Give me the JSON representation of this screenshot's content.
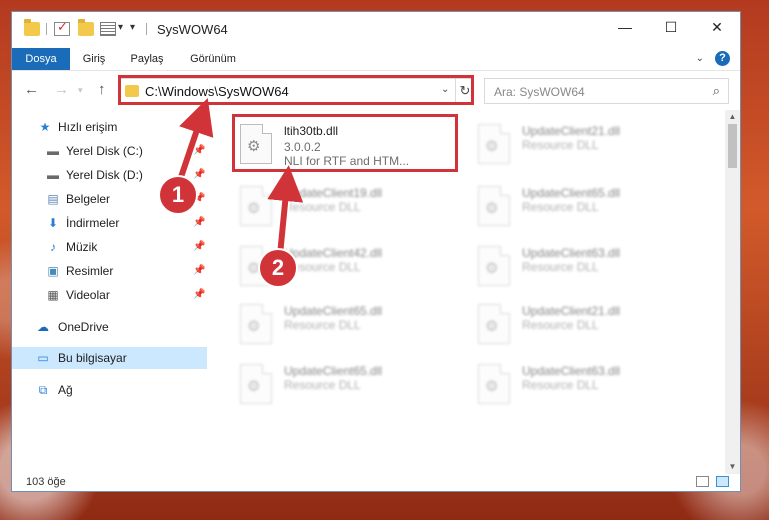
{
  "window": {
    "title": "SysWOW64",
    "minimize_glyph": "—",
    "maximize_glyph": "☐",
    "close_glyph": "✕"
  },
  "ribbon": {
    "tabs": [
      {
        "label": "Dosya",
        "active": true
      },
      {
        "label": "Giriş"
      },
      {
        "label": "Paylaş"
      },
      {
        "label": "Görünüm"
      }
    ],
    "help_glyph": "?"
  },
  "navigation": {
    "back_glyph": "←",
    "forward_glyph": "→",
    "up_glyph": "↑",
    "address": "C:\\Windows\\SysWOW64",
    "search_placeholder": "Ara: SysWOW64"
  },
  "sidebar": {
    "items": [
      {
        "label": "Hızlı erişim",
        "icon": "star-icon"
      },
      {
        "label": "Yerel Disk (C:)",
        "icon": "drive-icon",
        "pinned": true
      },
      {
        "label": "Yerel Disk (D:)",
        "icon": "drive-icon",
        "pinned": true
      },
      {
        "label": "Belgeler",
        "icon": "documents-icon",
        "pinned": true
      },
      {
        "label": "İndirmeler",
        "icon": "download-icon",
        "pinned": true
      },
      {
        "label": "Müzik",
        "icon": "music-icon",
        "pinned": true
      },
      {
        "label": "Resimler",
        "icon": "pictures-icon",
        "pinned": true
      },
      {
        "label": "Videolar",
        "icon": "video-icon",
        "pinned": true
      },
      {
        "label": "OneDrive",
        "icon": "cloud-icon"
      },
      {
        "label": "Bu bilgisayar",
        "icon": "computer-icon",
        "selected": true
      },
      {
        "label": "Ağ",
        "icon": "network-icon"
      }
    ]
  },
  "files": [
    {
      "name": "ltih30tb.dll",
      "version": "3.0.0.2",
      "description": "NLI for RTF and HTM...",
      "highlighted": true
    },
    {
      "name": "UpdateClient21.dll",
      "description": "Resource DLL"
    },
    {
      "name": "UpdateClient19.dll",
      "description": "Resource DLL"
    },
    {
      "name": "UpdateClient65.dll",
      "description": "Resource DLL"
    },
    {
      "name": "UpdateClient42.dll",
      "description": "Resource DLL"
    },
    {
      "name": "UpdateClient63.dll",
      "description": "Resource DLL"
    },
    {
      "name": "UpdateClient65.dll",
      "description": "Resource DLL"
    },
    {
      "name": "UpdateClient21.dll",
      "description": "Resource DLL"
    },
    {
      "name": "UpdateClient65.dll",
      "description": "Resource DLL"
    },
    {
      "name": "UpdateClient63.dll",
      "description": "Resource DLL"
    }
  ],
  "status": {
    "item_count": "103 öğe"
  },
  "annotations": {
    "step1": "1",
    "step2": "2",
    "color": "#d13438"
  }
}
